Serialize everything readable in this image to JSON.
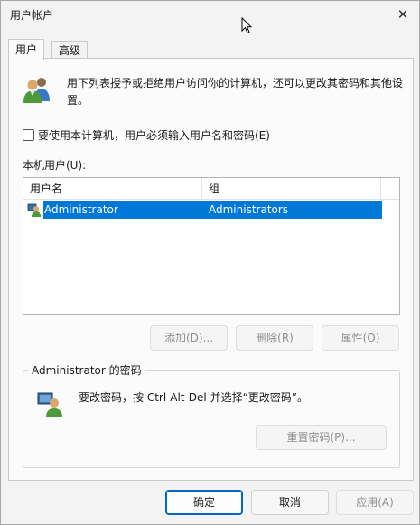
{
  "window": {
    "title": "用户帐户",
    "close_glyph": "✕"
  },
  "tabs": [
    {
      "label": "用户",
      "active": true
    },
    {
      "label": "高级",
      "active": false
    }
  ],
  "intro": {
    "text": "用下列表授予或拒绝用户访问你的计算机，还可以更改其密码和其他设置。",
    "icon": "users-icon"
  },
  "require_password": {
    "label": "要使用本计算机，用户必须输入用户名和密码(E)",
    "checked": false
  },
  "local_users": {
    "label": "本机用户(U):",
    "columns": [
      "用户名",
      "组"
    ],
    "rows": [
      {
        "name": "Administrator",
        "group": "Administrators",
        "selected": true,
        "icon": "user-icon"
      }
    ]
  },
  "list_buttons": {
    "add": "添加(D)...",
    "delete": "删除(R)",
    "properties": "属性(O)"
  },
  "password_group": {
    "title": "Administrator 的密码",
    "text": "要改密码，按 Ctrl-Alt-Del 并选择“更改密码”。",
    "reset_button": "重置密码(P)...",
    "icon": "user-key-icon"
  },
  "footer": {
    "ok": "确定",
    "cancel": "取消",
    "apply": "应用(A)"
  },
  "colors": {
    "selection": "#0078d7",
    "primary_border": "#0067c0",
    "window_bg": "#f3f3f3"
  }
}
